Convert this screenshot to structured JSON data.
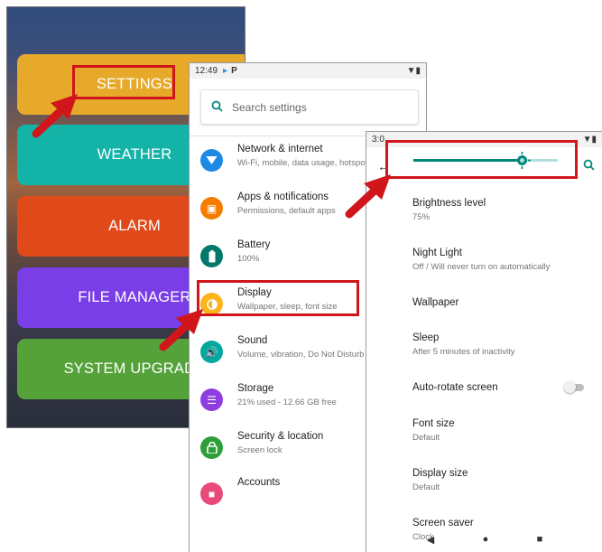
{
  "launcher": {
    "buttons": [
      {
        "label": "SETTINGS",
        "color": "#e6a92a"
      },
      {
        "label": "WEATHER",
        "color": "#13b3a8"
      },
      {
        "label": "ALARM",
        "color": "#e04a1a"
      },
      {
        "label": "FILE MANAGER",
        "color": "#7a3ee6"
      },
      {
        "label": "SYSTEM UPGRADE",
        "color": "#55a23a"
      }
    ]
  },
  "settings": {
    "status_time": "12:49",
    "search_placeholder": "Search settings",
    "items": [
      {
        "title": "Network & internet",
        "subtitle": "Wi-Fi, mobile, data usage, hotspot",
        "icon": "wifi-icon",
        "color": "#1e88e5"
      },
      {
        "title": "Apps & notifications",
        "subtitle": "Permissions, default apps",
        "icon": "apps-icon",
        "color": "#f57c00"
      },
      {
        "title": "Battery",
        "subtitle": "100%",
        "icon": "battery-icon",
        "color": "#00796b"
      },
      {
        "title": "Display",
        "subtitle": "Wallpaper, sleep, font size",
        "icon": "display-icon",
        "color": "#fbb41a"
      },
      {
        "title": "Sound",
        "subtitle": "Volume, vibration, Do Not Disturb",
        "icon": "sound-icon",
        "color": "#00a99d"
      },
      {
        "title": "Storage",
        "subtitle": "21% used - 12.66 GB free",
        "icon": "storage-icon",
        "color": "#8e3ee0"
      },
      {
        "title": "Security & location",
        "subtitle": "Screen lock",
        "icon": "lock-icon",
        "color": "#2e9e3a"
      },
      {
        "title": "Accounts",
        "subtitle": "",
        "icon": "account-icon",
        "color": "#e84a7a"
      }
    ]
  },
  "display": {
    "status_time": "3:0",
    "brightness_fraction": 0.75,
    "accent": "#00897b",
    "items": [
      {
        "title": "Brightness level",
        "subtitle": "75%"
      },
      {
        "title": "Night Light",
        "subtitle": "Off / Will never turn on automatically"
      },
      {
        "title": "Wallpaper",
        "subtitle": ""
      },
      {
        "title": "Sleep",
        "subtitle": "After 5 minutes of inactivity"
      },
      {
        "title": "Auto-rotate screen",
        "subtitle": ""
      },
      {
        "title": "Font size",
        "subtitle": "Default"
      },
      {
        "title": "Display size",
        "subtitle": "Default"
      },
      {
        "title": "Screen saver",
        "subtitle": "Clock"
      }
    ]
  }
}
